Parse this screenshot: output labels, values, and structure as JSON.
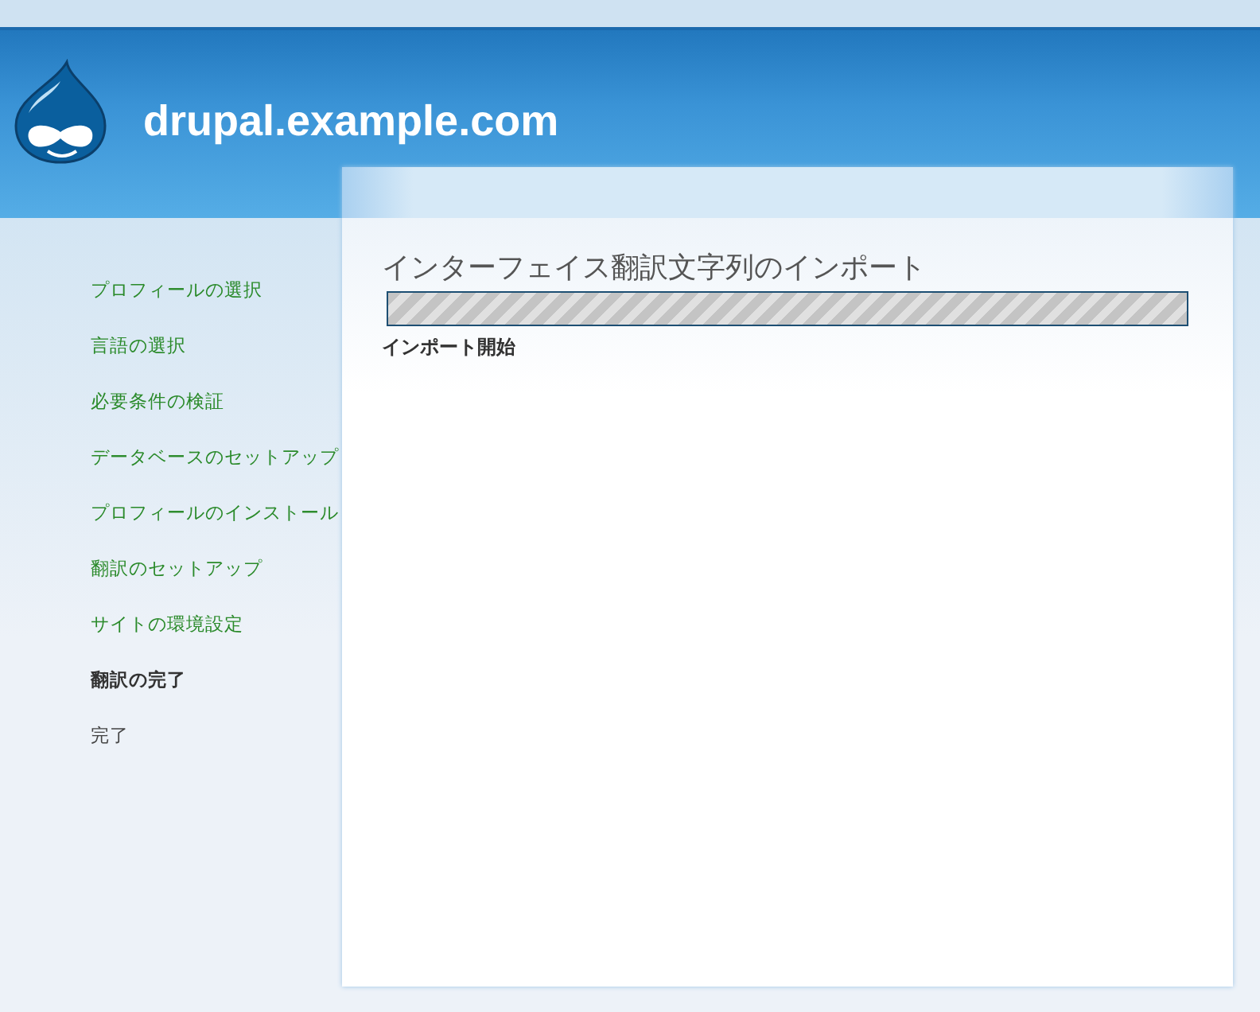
{
  "header": {
    "site_name": "drupal.example.com"
  },
  "sidebar": {
    "items": [
      {
        "label": "プロフィールの選択",
        "kind": "done"
      },
      {
        "label": "言語の選択",
        "kind": "done"
      },
      {
        "label": "必要条件の検証",
        "kind": "done"
      },
      {
        "label": "データベースのセットアップ",
        "kind": "done"
      },
      {
        "label": "プロフィールのインストール",
        "kind": "done"
      },
      {
        "label": "翻訳のセットアップ",
        "kind": "done"
      },
      {
        "label": "サイトの環境設定",
        "kind": "done"
      },
      {
        "label": "翻訳の完了",
        "kind": "active"
      },
      {
        "label": "完了",
        "kind": "pending"
      }
    ]
  },
  "content": {
    "title": "インターフェイス翻訳文字列のインポート",
    "progress": {
      "level": 1,
      "message": "インポート開始"
    }
  }
}
